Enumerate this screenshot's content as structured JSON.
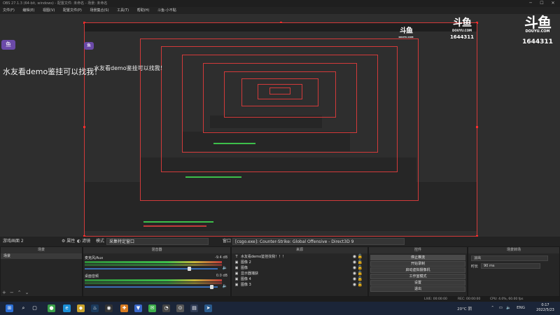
{
  "window": {
    "title": "OBS 27.1.3 (64-bit, windows) - 配置文件: 未命名 - 场景: 未命名"
  },
  "menu": [
    "文件(F)",
    "编辑(E)",
    "视图(V)",
    "配置文件(P)",
    "场景集合(S)",
    "工具(T)",
    "帮助(H)",
    "斗鱼-小不點"
  ],
  "preview": {
    "banner_text": "水友看demo鉴挂可以找我！",
    "logo": {
      "mark": "斗鱼",
      "sub": "DOUYU.COM",
      "room": "1644311"
    },
    "avatar_label": "鱼"
  },
  "midbar": {
    "scene_label": "游戏画面 2",
    "props_label": "属性",
    "filters_label": "滤镜",
    "mode_label": "模式",
    "mode_value": "采集特定窗口",
    "window_label": "窗口",
    "window_value": "[csgo.exe]: Counter-Strike: Global Offensive - Direct3D 9"
  },
  "docks": {
    "scenes": {
      "title": "场景",
      "items": [
        "场景"
      ]
    },
    "mixer": {
      "title": "混音器",
      "channels": [
        {
          "name": "麦克风/Aux",
          "db": "-9.4 dB",
          "level": 0.78
        },
        {
          "name": "桌面音频",
          "db": "0.0 dB",
          "level": 0.95
        }
      ]
    },
    "sources": {
      "title": "来源",
      "items": [
        {
          "icon": "T",
          "name": "水友看demo鉴挂找我！！！"
        },
        {
          "icon": "▣",
          "name": "图像 2"
        },
        {
          "icon": "▣",
          "name": "图像"
        },
        {
          "icon": "▣",
          "name": "显示器捕获"
        },
        {
          "icon": "▣",
          "name": "图像 4"
        },
        {
          "icon": "▣",
          "name": "图像 3"
        }
      ]
    },
    "controls": {
      "title": "控件",
      "buttons": [
        "停止推流",
        "开始录制",
        "启动虚拟摄像机",
        "工作室模式",
        "设置",
        "退出"
      ]
    },
    "transitions": {
      "title": "场景转场",
      "type_value": "淡出",
      "duration_label": "时长",
      "duration_value": "90 ms"
    }
  },
  "statusbar": {
    "live": "LIVE: 00:00:00",
    "rec": "REC: 00:00:00",
    "cpu": "CPU: 4.0%, 60.00 fps"
  },
  "taskbar": {
    "weather": "20°C 阴",
    "lang": "ENG",
    "time": "0:17",
    "date": "2022/5/23",
    "icons": [
      {
        "name": "windows-start-icon",
        "glyph": "⊞",
        "color": "#2b6fd6"
      },
      {
        "name": "search-icon",
        "glyph": "⌕",
        "color": "#1b2538"
      },
      {
        "name": "task-view-icon",
        "glyph": "▢",
        "color": "#1b2538"
      },
      {
        "name": "chrome-icon",
        "glyph": "●",
        "color": "#3aa04a"
      },
      {
        "name": "edge-icon",
        "glyph": "e",
        "color": "#1a8fd6"
      },
      {
        "name": "app-yellow-icon",
        "glyph": "◆",
        "color": "#c9a22a"
      },
      {
        "name": "steam-icon",
        "glyph": "♨",
        "color": "#1b3a5c"
      },
      {
        "name": "obs-icon",
        "glyph": "◉",
        "color": "#333333"
      },
      {
        "name": "app-orange-icon",
        "glyph": "✚",
        "color": "#d77a1f"
      },
      {
        "name": "app-blue-icon",
        "glyph": "▼",
        "color": "#3a68c9"
      },
      {
        "name": "wechat-icon",
        "glyph": "✉",
        "color": "#3cae4a"
      },
      {
        "name": "app-dark-icon",
        "glyph": "◔",
        "color": "#444444"
      },
      {
        "name": "clock-app-icon",
        "glyph": "⊙",
        "color": "#555555"
      },
      {
        "name": "csgo-icon",
        "glyph": "▤",
        "color": "#2f3b54"
      },
      {
        "name": "steam2-icon",
        "glyph": "➤",
        "color": "#2a5a8c"
      }
    ]
  }
}
